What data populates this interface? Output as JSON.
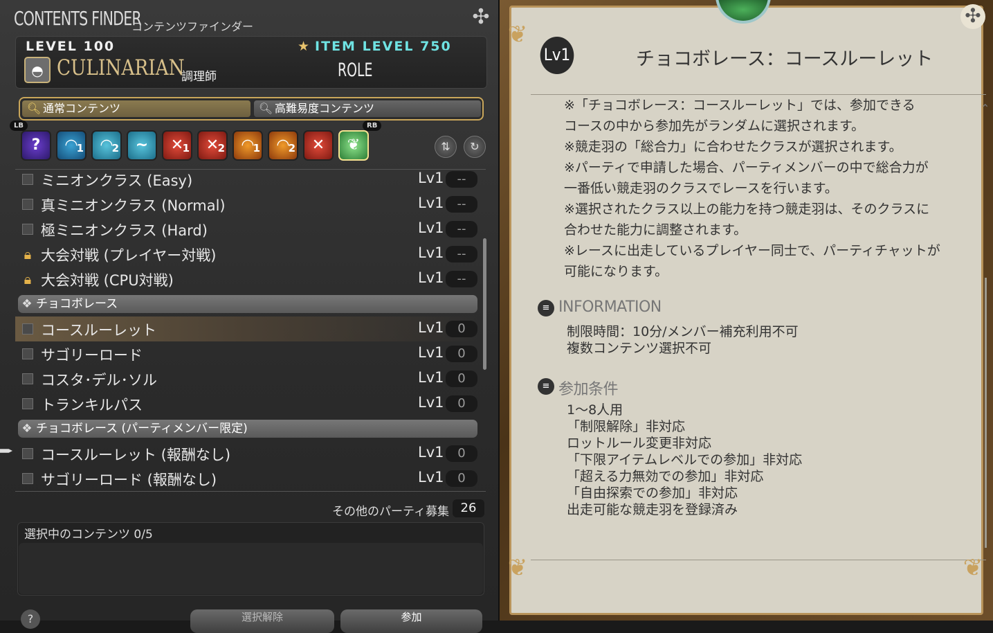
{
  "window": {
    "title": "CONTENTS FINDER",
    "title_jp": "コンテンツファインダー"
  },
  "job": {
    "level": "LEVEL 100",
    "item_level": "ITEM LEVEL 750",
    "name": "CULINARIAN",
    "name_jp": "調理師",
    "role": "ROLE"
  },
  "tabs": [
    {
      "label": "通常コンテンツ",
      "icon": "search-icon"
    },
    {
      "label": "高難易度コンテンツ",
      "icon": "search-icon"
    }
  ],
  "shoulder_labels": {
    "left": "LB",
    "right": "RB"
  },
  "category_icons": [
    {
      "glyph": "?",
      "num": "",
      "name": "roulette-icon"
    },
    {
      "glyph": "◠",
      "num": "1",
      "name": "dungeon-icon"
    },
    {
      "glyph": "◠",
      "num": "2",
      "name": "dungeon-icon"
    },
    {
      "glyph": "~",
      "num": "",
      "name": "guildhest-icon"
    },
    {
      "glyph": "✕",
      "num": "1",
      "name": "trial-icon"
    },
    {
      "glyph": "✕",
      "num": "2",
      "name": "trial-icon"
    },
    {
      "glyph": "◠",
      "num": "1",
      "name": "raid-icon"
    },
    {
      "glyph": "◠",
      "num": "2",
      "name": "raid-icon"
    },
    {
      "glyph": "✕",
      "num": "",
      "name": "pvp-icon"
    },
    {
      "glyph": "❦",
      "num": "",
      "name": "gold-saucer-icon"
    }
  ],
  "list": [
    {
      "type": "item",
      "name": "ミニオンクラス (Easy)",
      "lv": "Lv1",
      "count": "--",
      "locked": false,
      "selected": false
    },
    {
      "type": "item",
      "name": "真ミニオンクラス (Normal)",
      "lv": "Lv1",
      "count": "--",
      "locked": false,
      "selected": false
    },
    {
      "type": "item",
      "name": "極ミニオンクラス (Hard)",
      "lv": "Lv1",
      "count": "--",
      "locked": false,
      "selected": false
    },
    {
      "type": "item",
      "name": "大会対戦 (プレイヤー対戦)",
      "lv": "Lv1",
      "count": "--",
      "locked": true,
      "selected": false
    },
    {
      "type": "item",
      "name": "大会対戦 (CPU対戦)",
      "lv": "Lv1",
      "count": "--",
      "locked": true,
      "selected": false
    },
    {
      "type": "category",
      "name": "チョコボレース"
    },
    {
      "type": "item",
      "name": "コースルーレット",
      "lv": "Lv1",
      "count": "0",
      "locked": false,
      "selected": true
    },
    {
      "type": "item",
      "name": "サゴリーロード",
      "lv": "Lv1",
      "count": "0",
      "locked": false,
      "selected": false
    },
    {
      "type": "item",
      "name": "コスタ･デル･ソル",
      "lv": "Lv1",
      "count": "0",
      "locked": false,
      "selected": false
    },
    {
      "type": "item",
      "name": "トランキルパス",
      "lv": "Lv1",
      "count": "0",
      "locked": false,
      "selected": false
    },
    {
      "type": "category",
      "name": "チョコボレース (パーティメンバー限定)"
    },
    {
      "type": "item",
      "name": "コースルーレット (報酬なし)",
      "lv": "Lv1",
      "count": "0",
      "locked": false,
      "selected": false
    },
    {
      "type": "item",
      "name": "サゴリーロード (報酬なし)",
      "lv": "Lv1",
      "count": "0",
      "locked": false,
      "selected": false
    }
  ],
  "party": {
    "label": "その他のパーティ募集",
    "count": "26"
  },
  "selection": {
    "label": "選択中のコンテンツ 0/5"
  },
  "buttons": {
    "help": "?",
    "clear": "選択解除",
    "join": "参加"
  },
  "detail": {
    "level": "Lv1",
    "title": "チョコボレース：コースルーレット",
    "description": [
      "※「チョコボレース：コースルーレット」では、参加できる",
      "コースの中から参加先がランダムに選択されます。",
      "※競走羽の「総合力」に合わせたクラスが選択されます。",
      "※パーティで申請した場合、パーティメンバーの中で総合力が",
      "一番低い競走羽のクラスでレースを行います。",
      "※選択されたクラス以上の能力を持つ競走羽は、そのクラスに",
      "合わせた能力に調整されます。",
      "※レースに出走しているプレイヤー同士で、パーティチャットが",
      "可能になります。"
    ],
    "information_title": "INFORMATION",
    "information": [
      "制限時間：10分/メンバー補充利用不可",
      "複数コンテンツ選択不可"
    ],
    "conditions_title": "参加条件",
    "conditions": [
      "1～8人用",
      "「制限解除」非対応",
      "ロットルール変更非対応",
      "「下限アイテムレベルでの参加」非対応",
      "「超える力無効での参加」非対応",
      "「自由探索での参加」非対応",
      "出走可能な競走羽を登録済み"
    ]
  },
  "colors": {
    "accent": "#c9a65a",
    "item_level": "#6fe3e3",
    "job_name": "#d8c08a"
  }
}
